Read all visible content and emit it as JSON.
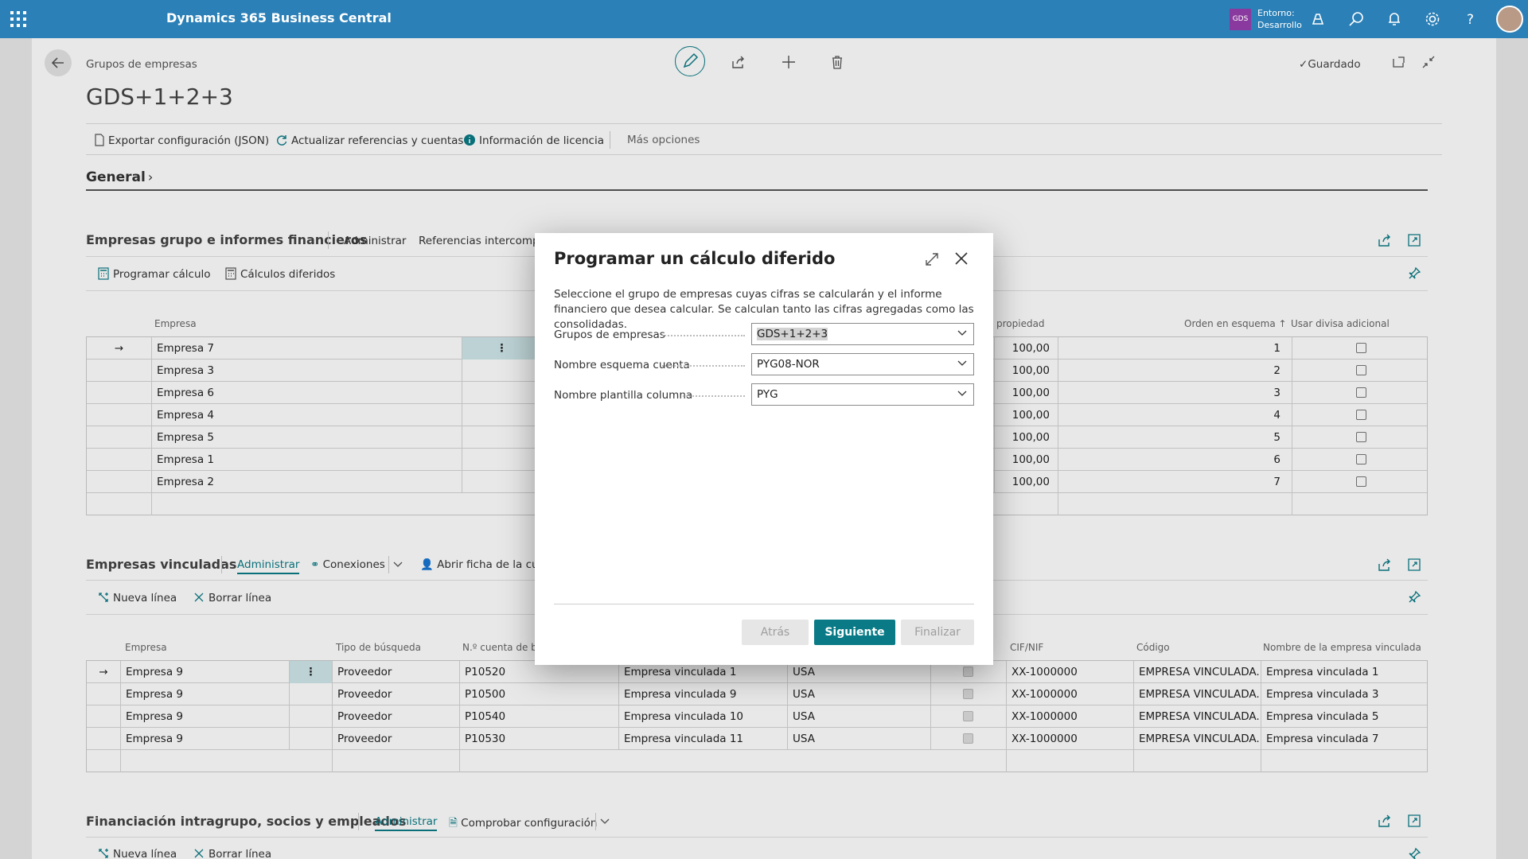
{
  "topbar": {
    "brand": "Dynamics 365 Business Central",
    "company_badge": "GDS",
    "env_label": "Entorno:",
    "env_value": "Desarrollo"
  },
  "page": {
    "breadcrumb": "Grupos de empresas",
    "title": "GDS+1+2+3",
    "saved": "Guardado",
    "actions": [
      "Exportar configuración (JSON)",
      "Actualizar referencias y cuentas",
      "Información de licencia",
      "Más opciones"
    ],
    "general": "General"
  },
  "section1": {
    "title": "Empresas grupo e informes financieros",
    "actions": [
      "Administrar",
      "Referencias intercompa"
    ],
    "sub_actions": [
      "Programar cálculo",
      "Cálculos diferidos"
    ],
    "columns": {
      "empresa": "Empresa",
      "propiedad": "propiedad",
      "orden": "Orden en esquema ↑",
      "divisa": "Usar divisa adicional"
    },
    "rows": [
      {
        "empresa": "Empresa 7",
        "propiedad": "100,00",
        "orden": "1"
      },
      {
        "empresa": "Empresa 3",
        "propiedad": "100,00",
        "orden": "2"
      },
      {
        "empresa": "Empresa 6",
        "propiedad": "100,00",
        "orden": "3"
      },
      {
        "empresa": "Empresa 4",
        "propiedad": "100,00",
        "orden": "4"
      },
      {
        "empresa": "Empresa 5",
        "propiedad": "100,00",
        "orden": "5"
      },
      {
        "empresa": "Empresa 1",
        "propiedad": "100,00",
        "orden": "6"
      },
      {
        "empresa": "Empresa 2",
        "propiedad": "100,00",
        "orden": "7"
      }
    ]
  },
  "section2": {
    "title": "Empresas vinculadas",
    "actions": [
      "Administrar",
      "Conexiones",
      "Abrir ficha de la cuen"
    ],
    "sub_actions": [
      "Nueva línea",
      "Borrar línea"
    ],
    "columns": {
      "empresa": "Empresa",
      "tipo": "Tipo de búsqueda",
      "cuenta": "N.º cuenta de bús",
      "cif": "CIF/NIF",
      "codigo": "Código",
      "nombre": "Nombre de la empresa vinculada"
    },
    "rows": [
      {
        "empresa": "Empresa 9",
        "tipo": "Proveedor",
        "cuenta": "P10520",
        "vinc": "Empresa vinculada 1",
        "pais": "USA",
        "cif": "XX-1000000",
        "codigo": "EMPRESA VINCULADA...",
        "nombre": "Empresa vinculada 1"
      },
      {
        "empresa": "Empresa 9",
        "tipo": "Proveedor",
        "cuenta": "P10500",
        "vinc": "Empresa vinculada 9",
        "pais": "USA",
        "cif": "XX-1000000",
        "codigo": "EMPRESA VINCULADA...",
        "nombre": "Empresa vinculada 3"
      },
      {
        "empresa": "Empresa 9",
        "tipo": "Proveedor",
        "cuenta": "P10540",
        "vinc": "Empresa vinculada 10",
        "pais": "USA",
        "cif": "XX-1000000",
        "codigo": "EMPRESA VINCULADA...",
        "nombre": "Empresa vinculada 5"
      },
      {
        "empresa": "Empresa 9",
        "tipo": "Proveedor",
        "cuenta": "P10530",
        "vinc": "Empresa vinculada 11",
        "pais": "USA",
        "cif": "XX-1000000",
        "codigo": "EMPRESA VINCULADA...",
        "nombre": "Empresa vinculada 7"
      }
    ]
  },
  "section3": {
    "title": "Financiación intragrupo, socios y empleados",
    "actions": [
      "Administrar",
      "Comprobar configuración"
    ],
    "sub_actions": [
      "Nueva línea",
      "Borrar línea"
    ]
  },
  "dialog": {
    "title": "Programar un cálculo diferido",
    "description": "Seleccione el grupo de empresas cuyas cifras se calcularán y el informe financiero que desea calcular. Se calculan tanto las cifras agregadas como las consolidadas.",
    "fields": [
      {
        "label": "Grupos de empresas",
        "value": "GDS+1+2+3"
      },
      {
        "label": "Nombre esquema cuenta",
        "value": "PYG08-NOR"
      },
      {
        "label": "Nombre plantilla columna",
        "value": "PYG"
      }
    ],
    "buttons": {
      "back": "Atrás",
      "next": "Siguiente",
      "finish": "Finalizar"
    }
  },
  "colors": {
    "topbar": "#2b80b7",
    "accent": "#0a7b86"
  }
}
